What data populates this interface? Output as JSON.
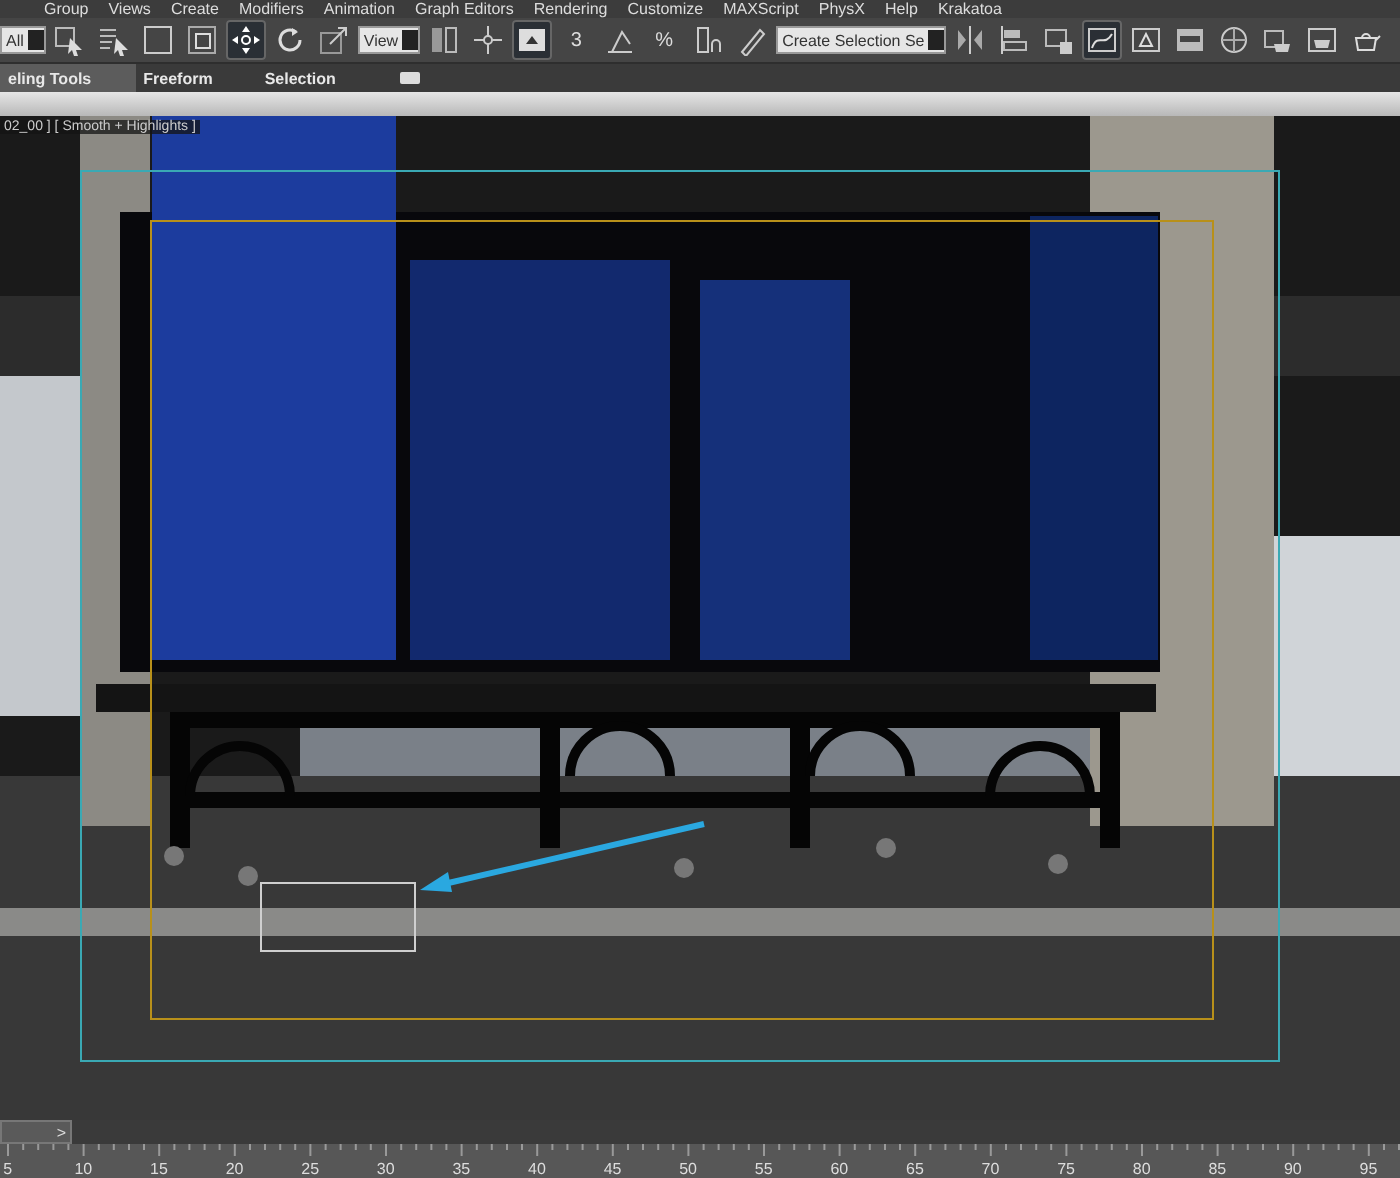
{
  "menu_bar": [
    "Group",
    "Views",
    "Create",
    "Modifiers",
    "Animation",
    "Graph Editors",
    "Rendering",
    "Customize",
    "MAXScript",
    "PhysX",
    "Help",
    "Krakatoa"
  ],
  "toolbar": [
    {
      "kind": "dropdown",
      "value": "All"
    },
    {
      "kind": "tool",
      "selected": false
    },
    {
      "kind": "tool",
      "selected": false
    },
    {
      "kind": "tool",
      "selected": false
    },
    {
      "kind": "tool",
      "selected": false
    },
    {
      "kind": "tool",
      "selected": true
    },
    {
      "kind": "tool",
      "selected": false
    },
    {
      "kind": "tool",
      "selected": false
    },
    {
      "kind": "dropdown",
      "value": "View"
    },
    {
      "kind": "tool",
      "selected": false
    },
    {
      "kind": "tool",
      "selected": false
    },
    {
      "kind": "tool",
      "selected": true
    },
    {
      "kind": "snap",
      "label": "3",
      "selected": false
    },
    {
      "kind": "tool",
      "selected": false
    },
    {
      "kind": "snap",
      "label": "%",
      "selected": false
    },
    {
      "kind": "tool",
      "selected": false
    },
    {
      "kind": "tool",
      "selected": false
    },
    {
      "kind": "dropdown",
      "value": "Create Selection Se"
    },
    {
      "kind": "tool",
      "selected": false
    },
    {
      "kind": "tool",
      "selected": false
    },
    {
      "kind": "tool",
      "selected": false
    },
    {
      "kind": "tool",
      "selected": true
    },
    {
      "kind": "tool",
      "selected": false
    },
    {
      "kind": "tool",
      "selected": false
    },
    {
      "kind": "tool",
      "selected": false
    },
    {
      "kind": "tool",
      "selected": false
    },
    {
      "kind": "tool",
      "selected": false
    },
    {
      "kind": "tool",
      "selected": false
    }
  ],
  "ribbon_tabs": [
    {
      "label": "eling Tools",
      "selected": true
    },
    {
      "label": "Freeform",
      "selected": false
    },
    {
      "label": "Selection",
      "selected": false
    }
  ],
  "viewport": {
    "label": "02_00 ] [ Smooth + Highlights ]"
  },
  "time_slider": {
    "button": ">"
  },
  "track_bar": {
    "ticks": [
      "5",
      "10",
      "15",
      "20",
      "25",
      "30",
      "35",
      "40",
      "45",
      "50",
      "55",
      "60",
      "65",
      "70",
      "75",
      "80",
      "85",
      "90",
      "95"
    ]
  }
}
